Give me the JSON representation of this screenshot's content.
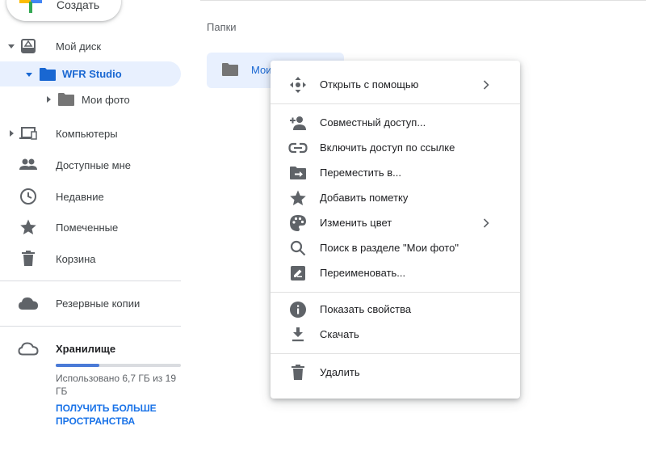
{
  "create_button": {
    "label": "Создать"
  },
  "sidebar": {
    "my_drive": "Мой диск",
    "wfr_studio": "WFR Studio",
    "my_photos": "Мои фото",
    "computers": "Компьютеры",
    "shared": "Доступные мне",
    "recent": "Недавние",
    "starred": "Помеченные",
    "trash": "Корзина",
    "backups": "Резервные копии",
    "storage": "Хранилище",
    "storage_used": "Использовано 6,7 ГБ из 19 ГБ",
    "storage_fraction": 0.35,
    "get_more": "ПОЛУЧИТЬ БОЛЬШЕ ПРОСТРАНСТВА"
  },
  "main": {
    "section_title": "Папки",
    "folder_name": "Мои"
  },
  "context_menu": {
    "open_with": "Открыть с помощью",
    "share": "Совместный доступ...",
    "link": "Включить доступ по ссылке",
    "move": "Переместить в...",
    "star": "Добавить пометку",
    "color": "Изменить цвет",
    "search": "Поиск в разделе \"Мои фото\"",
    "rename": "Переименовать...",
    "details": "Показать свойства",
    "download": "Скачать",
    "delete": "Удалить"
  },
  "colors": {
    "accent": "#1a73e8",
    "active_bg": "#e8f0fe",
    "folder_blue": "#4a7ad7",
    "icon_gray": "#5f6368"
  }
}
